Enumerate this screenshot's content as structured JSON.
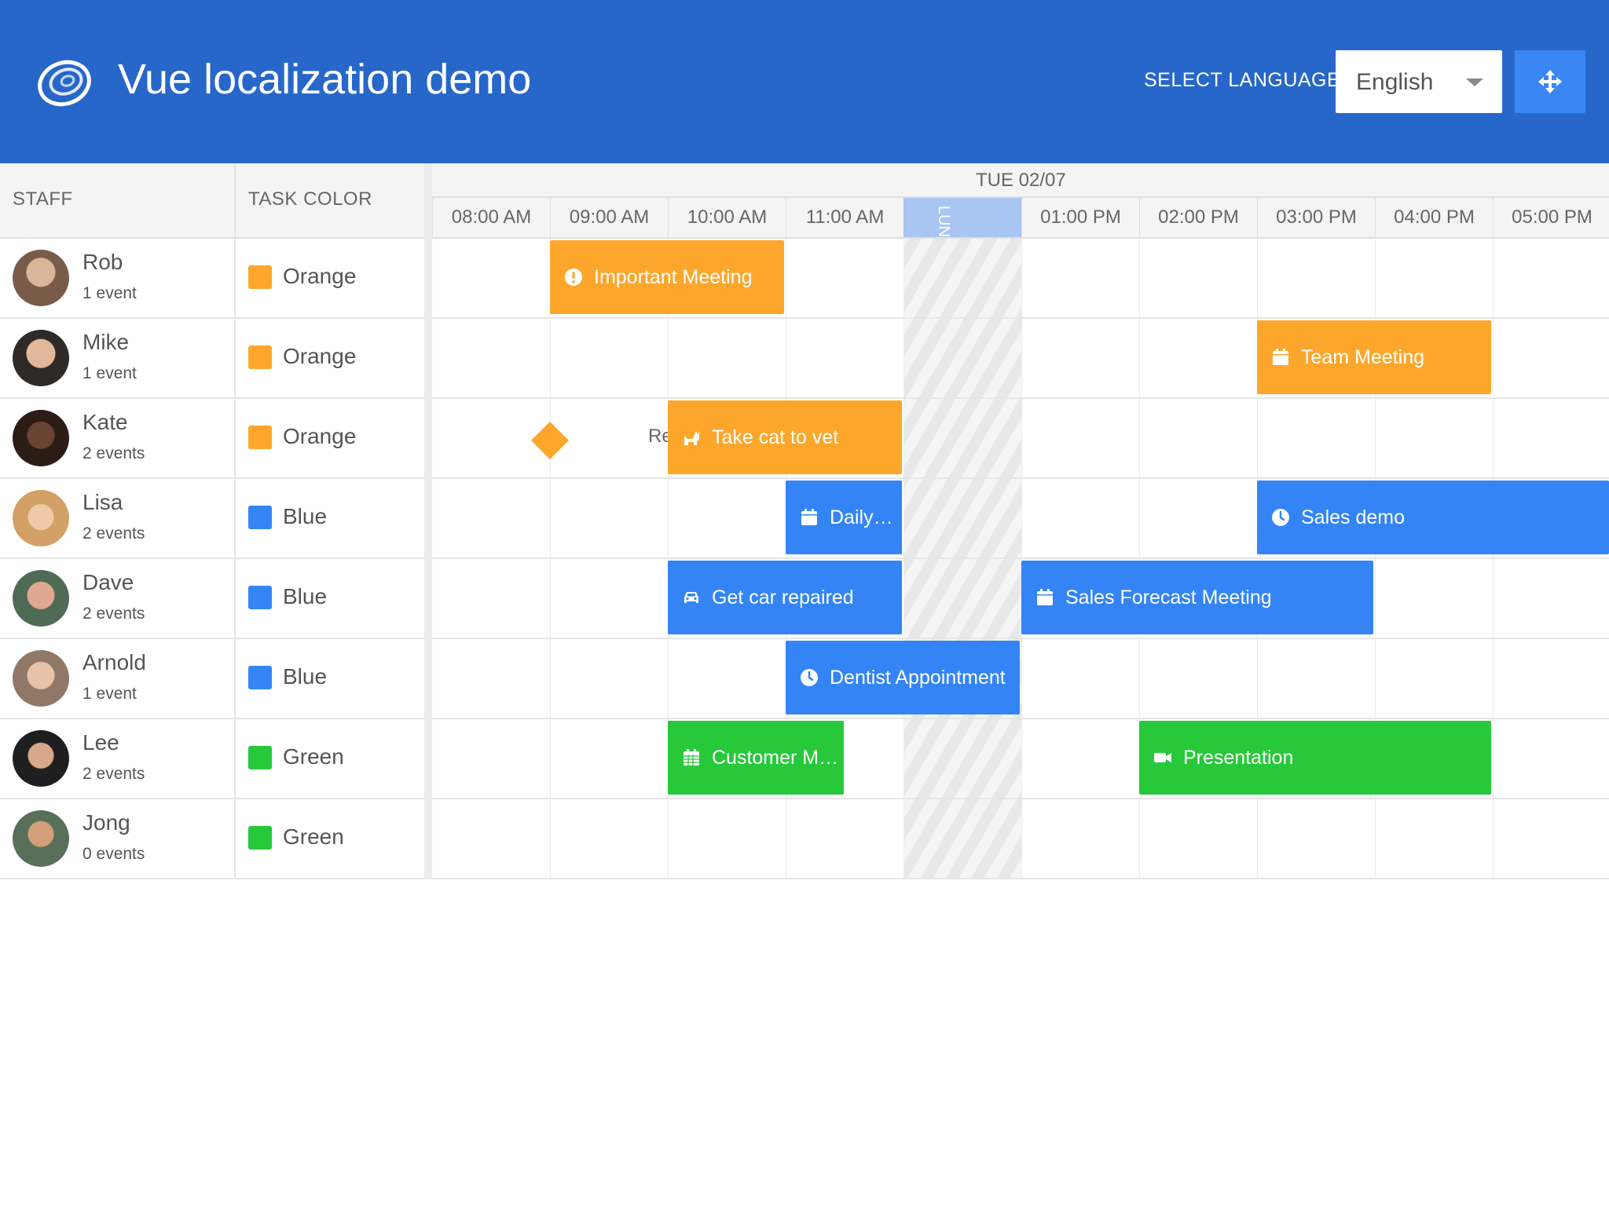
{
  "header": {
    "title": "Vue localization demo",
    "language_label": "SELECT LANGUAGE",
    "language_value": "English",
    "drag_icon": "move-icon",
    "logo_icon": "spiral-logo-icon"
  },
  "columns": {
    "staff": "STAFF",
    "task_color": "TASK COLOR"
  },
  "timeline": {
    "date": "TUE 02/07",
    "hours": [
      "08:00 AM",
      "09:00 AM",
      "10:00 AM",
      "11:00 AM",
      "",
      "01:00 PM",
      "02:00 PM",
      "03:00 PM",
      "04:00 PM",
      "05:00 PM"
    ],
    "lunch_label": "LUNC"
  },
  "staff": [
    {
      "name": "Rob",
      "events": "1 event",
      "color": "Orange",
      "swatch": "#fca72c",
      "avatar": "#7a5b4a"
    },
    {
      "name": "Mike",
      "events": "1 event",
      "color": "Orange",
      "swatch": "#fca72c",
      "avatar": "#5b4f48"
    },
    {
      "name": "Kate",
      "events": "2 events",
      "color": "Orange",
      "swatch": "#fca72c",
      "avatar": "#4a3328"
    },
    {
      "name": "Lisa",
      "events": "2 events",
      "color": "Blue",
      "swatch": "#3484f6",
      "avatar": "#c99a6a"
    },
    {
      "name": "Dave",
      "events": "2 events",
      "color": "Blue",
      "swatch": "#3484f6",
      "avatar": "#6a7a6a"
    },
    {
      "name": "Arnold",
      "events": "1 event",
      "color": "Blue",
      "swatch": "#3484f6",
      "avatar": "#8c6a56"
    },
    {
      "name": "Lee",
      "events": "2 events",
      "color": "Green",
      "swatch": "#27c83a",
      "avatar": "#3a3a3a"
    },
    {
      "name": "Jong",
      "events": "0 events",
      "color": "Green",
      "swatch": "#27c83a",
      "avatar": "#5a7a5a"
    }
  ],
  "events": {
    "important_meeting": {
      "label": "Important Meeting",
      "icon": "exclamation-circle-icon"
    },
    "team_meeting": {
      "label": "Team Meeting",
      "icon": "calendar-icon"
    },
    "take_cat_to_vet": {
      "label": "Take cat to vet",
      "icon": "cat-icon"
    },
    "daily": {
      "label": "Daily…",
      "icon": "calendar-icon"
    },
    "sales_demo": {
      "label": "Sales demo",
      "icon": "clock-icon"
    },
    "get_car_repaired": {
      "label": "Get car repaired",
      "icon": "car-icon"
    },
    "sales_forecast_meeting": {
      "label": "Sales Forecast Meeting",
      "icon": "calendar-icon"
    },
    "dentist_appointment": {
      "label": "Dentist Appointment",
      "icon": "clock-icon"
    },
    "customer_meeting": {
      "label": "Customer M…",
      "icon": "calendar-grid-icon"
    },
    "presentation": {
      "label": "Presentation",
      "icon": "video-icon"
    },
    "milestone_label": "Re"
  }
}
